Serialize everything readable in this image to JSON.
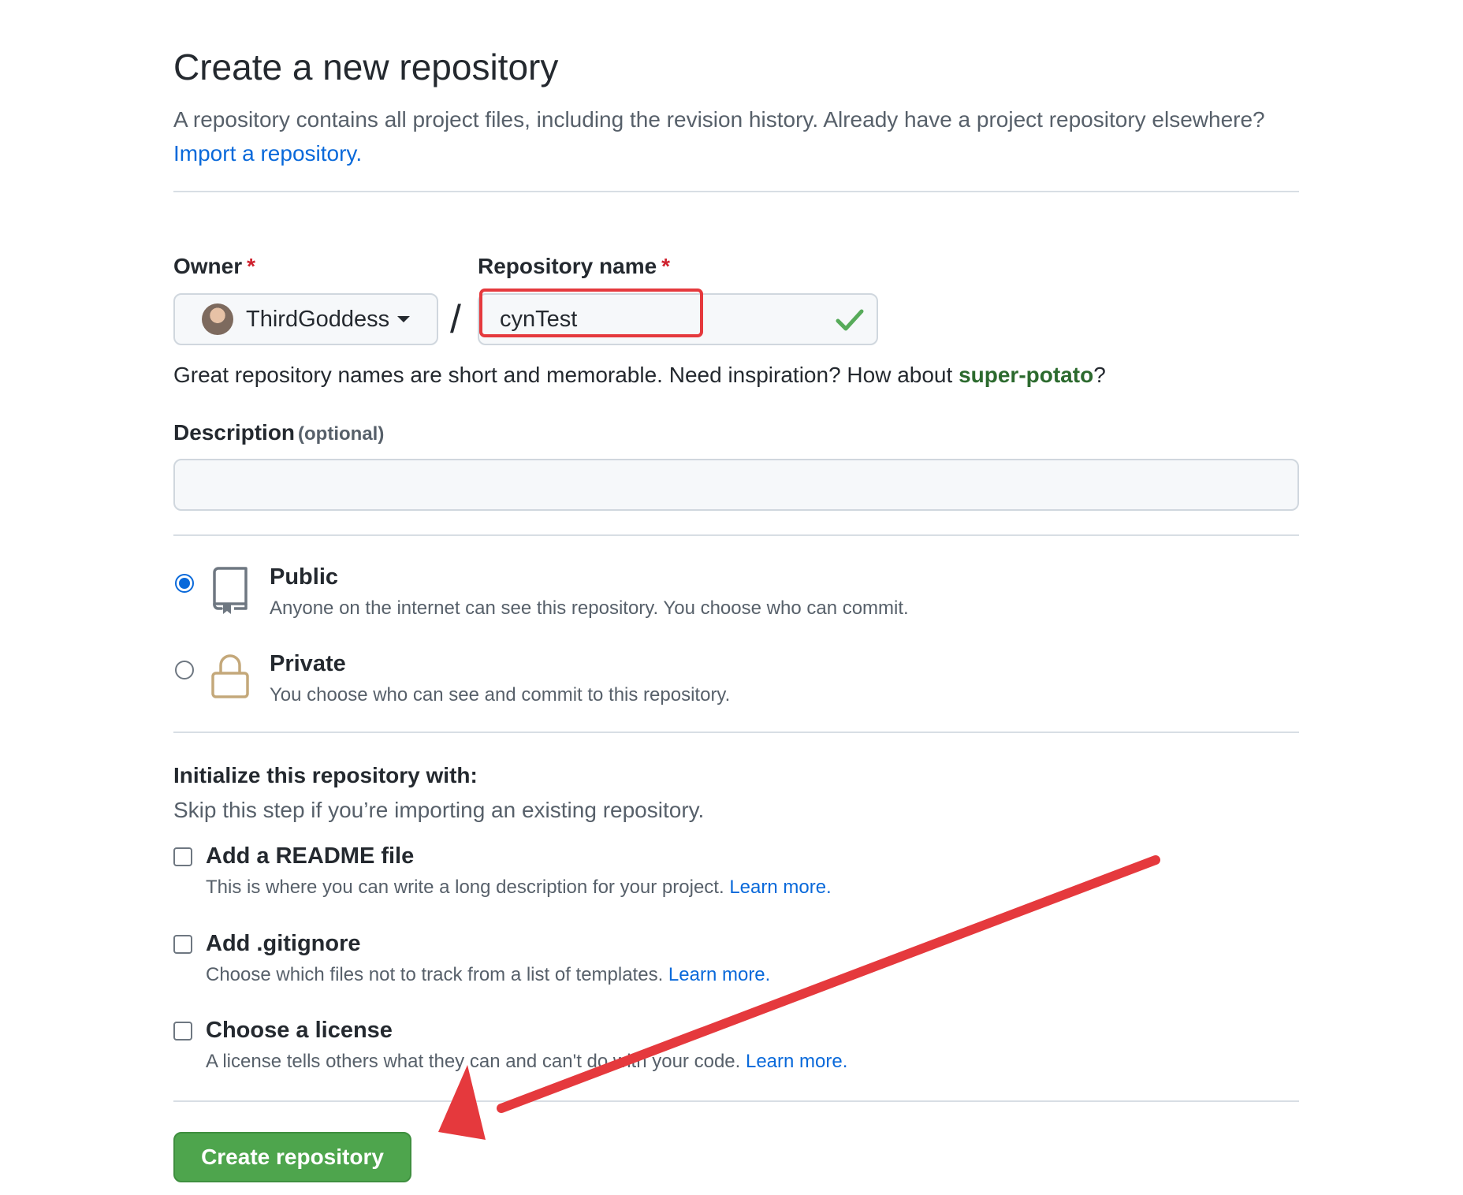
{
  "header": {
    "title": "Create a new repository",
    "subtitle_text": "A repository contains all project files, including the revision history. Already have a project repository elsewhere?",
    "import_link": "Import a repository."
  },
  "owner": {
    "label": "Owner",
    "required_mark": "*",
    "value": "ThirdGoddess"
  },
  "repo_name": {
    "label": "Repository name",
    "required_mark": "*",
    "value": "cynTest",
    "valid_icon": "check-icon"
  },
  "name_hint": {
    "text": "Great repository names are short and memorable. Need inspiration? How about",
    "suggestion": "super-potato",
    "suffix": "?"
  },
  "description": {
    "label": "Description",
    "optional": "(optional)",
    "value": ""
  },
  "visibility": [
    {
      "title": "Public",
      "desc": "Anyone on the internet can see this repository. You choose who can commit.",
      "icon": "repo-icon",
      "selected": true
    },
    {
      "title": "Private",
      "desc": "You choose who can see and commit to this repository.",
      "icon": "lock-icon",
      "selected": false
    }
  ],
  "initialize": {
    "title": "Initialize this repository with:",
    "subtitle": "Skip this step if you’re importing an existing repository.",
    "options": [
      {
        "title": "Add a README file",
        "desc": "This is where you can write a long description for your project.",
        "link": "Learn more.",
        "checked": false
      },
      {
        "title": "Add .gitignore",
        "desc": "Choose which files not to track from a list of templates.",
        "link": "Learn more.",
        "checked": false
      },
      {
        "title": "Choose a license",
        "desc": "A license tells others what they can and can't do with your code.",
        "link": "Learn more.",
        "checked": false
      }
    ]
  },
  "submit": {
    "label": "Create repository"
  },
  "colors": {
    "accent_blue": "#0969da",
    "create_green": "#4ea54d",
    "annotation_red": "#e5393d",
    "valid_check": "#57ab5a"
  }
}
